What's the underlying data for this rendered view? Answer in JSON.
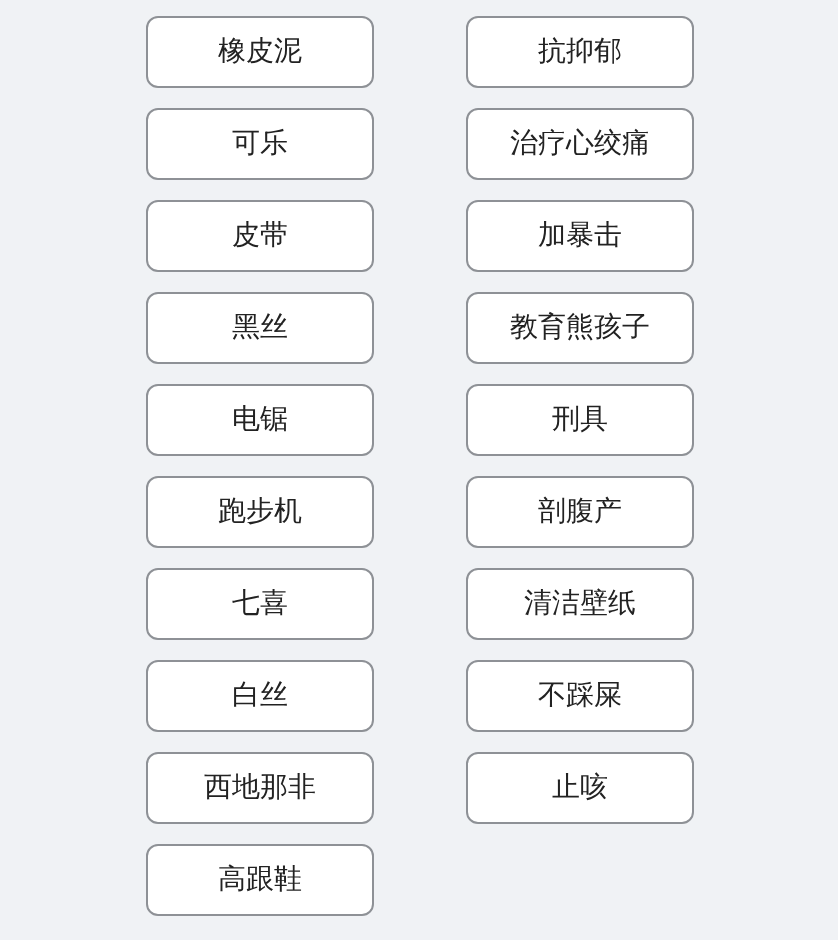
{
  "buttons": [
    {
      "left": "橡皮泥",
      "right": "抗抑郁"
    },
    {
      "left": "可乐",
      "right": "治疗心绞痛"
    },
    {
      "left": "皮带",
      "right": "加暴击"
    },
    {
      "left": "黑丝",
      "right": "教育熊孩子"
    },
    {
      "left": "电锯",
      "right": "刑具"
    },
    {
      "left": "跑步机",
      "right": "剖腹产"
    },
    {
      "left": "七喜",
      "right": "清洁壁纸"
    },
    {
      "left": "白丝",
      "right": "不踩屎"
    },
    {
      "left": "西地那非",
      "right": "止咳"
    },
    {
      "left": "高跟鞋"
    }
  ]
}
